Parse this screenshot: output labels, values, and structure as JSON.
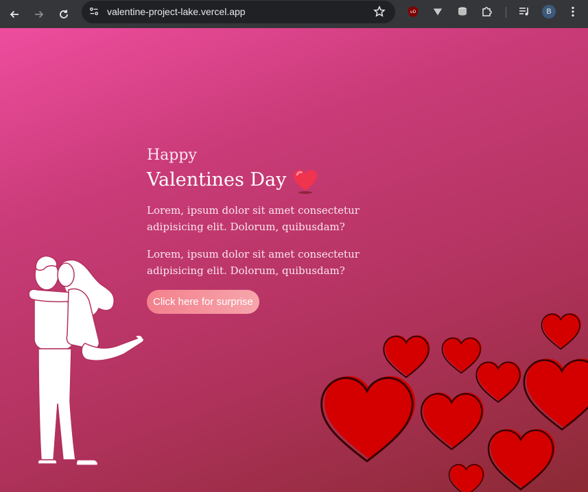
{
  "browser": {
    "url": "valentine-project-lake.vercel.app",
    "profile_initial": "B",
    "icons": [
      "back-icon",
      "forward-icon",
      "reload-icon",
      "site-info-icon",
      "star-icon",
      "ublock-icon",
      "extension-icon",
      "extension-icon",
      "puzzle-icon",
      "media-icon",
      "avatar",
      "menu-icon"
    ]
  },
  "page": {
    "greeting": "Happy",
    "title": "Valentines Day",
    "paragraphs": [
      "Lorem, ipsum dolor sit amet consectetur adipisicing elit. Dolorum, quibusdam?",
      "Lorem, ipsum dolor sit amet consectetur adipisicing elit. Dolorum, quibusdam?"
    ],
    "button_label": "Click here for surprise",
    "colors": {
      "gradient_start": "#ee4d9e",
      "gradient_end": "#8b2a35",
      "heart_red": "#d40000",
      "button": "#f58f99"
    }
  }
}
